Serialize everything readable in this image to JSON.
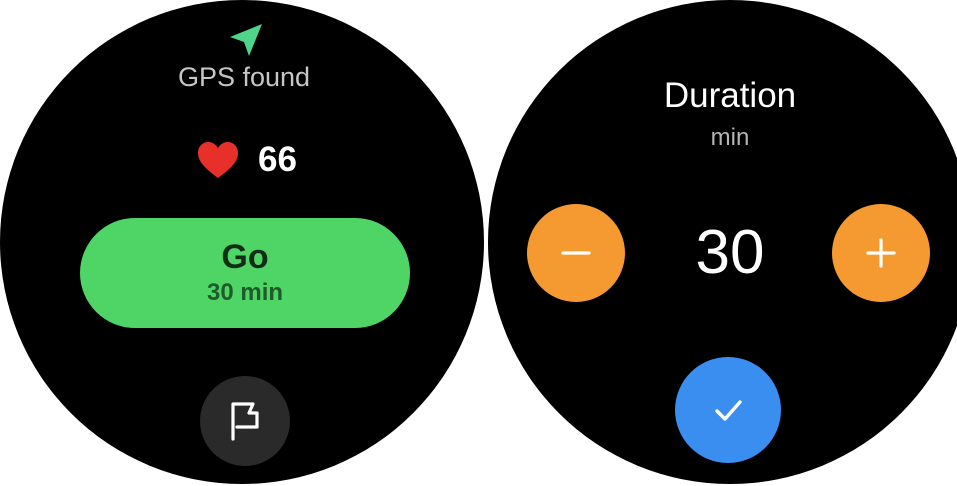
{
  "left_screen": {
    "gps_icon": "navigation-arrow-icon",
    "gps_status": "GPS found",
    "heart_icon": "heart-icon",
    "heart_rate": "66",
    "go_button": {
      "label": "Go",
      "duration": "30 min"
    },
    "flag_icon": "flag-icon"
  },
  "right_screen": {
    "title": "Duration",
    "unit": "min",
    "value": "30",
    "minus_icon": "minus-icon",
    "plus_icon": "plus-icon",
    "confirm_icon": "check-icon"
  },
  "colors": {
    "go_green": "#4fd566",
    "gps_arrow": "#4fd58a",
    "heart_red": "#e8302a",
    "stepper_orange": "#f59a30",
    "confirm_blue": "#3a8ef0",
    "background": "#000000"
  }
}
